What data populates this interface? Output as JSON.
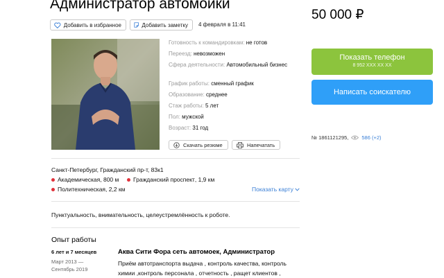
{
  "header": {
    "title": "Администратор автомойки",
    "price": "50 000 ₽"
  },
  "actions": {
    "favorite_label": "Добавить в избранное",
    "note_label": "Добавить заметку",
    "date": "4 февраля в 11:41",
    "download_label": "Скачать резюме",
    "print_label": "Напечатать"
  },
  "details": [
    {
      "label": "Готовность к командировкам:",
      "value": "не готов"
    },
    {
      "label": "Переезд:",
      "value": "невозможен"
    },
    {
      "label": "Сфера деятельности:",
      "value": "Автомобильный бизнес"
    },
    {
      "label": "График работы:",
      "value": "сменный график"
    },
    {
      "label": "Образование:",
      "value": "среднее"
    },
    {
      "label": "Стаж работы:",
      "value": "5 лет"
    },
    {
      "label": "Пол:",
      "value": "мужской"
    },
    {
      "label": "Возраст:",
      "value": "31 год"
    }
  ],
  "contact": {
    "phone_label": "Показать телефон",
    "phone_masked": "8 952 XXX XX XX",
    "write_label": "Написать соискателю"
  },
  "meta": {
    "number": "№ 1861121295,",
    "views": "586 (+2)"
  },
  "location": {
    "address": "Санкт-Петербург, Гражданский пр-т, 83к1",
    "metro": [
      {
        "name": "Академическая",
        "distance": "800 м"
      },
      {
        "name": "Гражданский проспект",
        "distance": "1,9 км"
      },
      {
        "name": "Политехническая",
        "distance": "2,2 км"
      }
    ],
    "show_map": "Показать карту"
  },
  "about": "Пунктуальность, внимательность, целеустремлённость к роботе.",
  "experience": {
    "heading": "Опыт работы",
    "duration": "6 лет и 7 месяцев",
    "period_line1": "Март 2013 —",
    "period_line2": "Сентябрь 2019",
    "job_title": "Аква Сити Фора сеть автомоек, Администратор",
    "job_desc_line1": "Приём автотранспорта выдача , контроль качества, контроль",
    "job_desc_line2": "химии ,контроль персонала , отчетность , ращет клиентов ,"
  },
  "colors": {
    "phone_button": "#8cc43d",
    "write_button": "#2f9ff8",
    "link": "#3a7fd6",
    "metro_dot": "#e0313a"
  }
}
